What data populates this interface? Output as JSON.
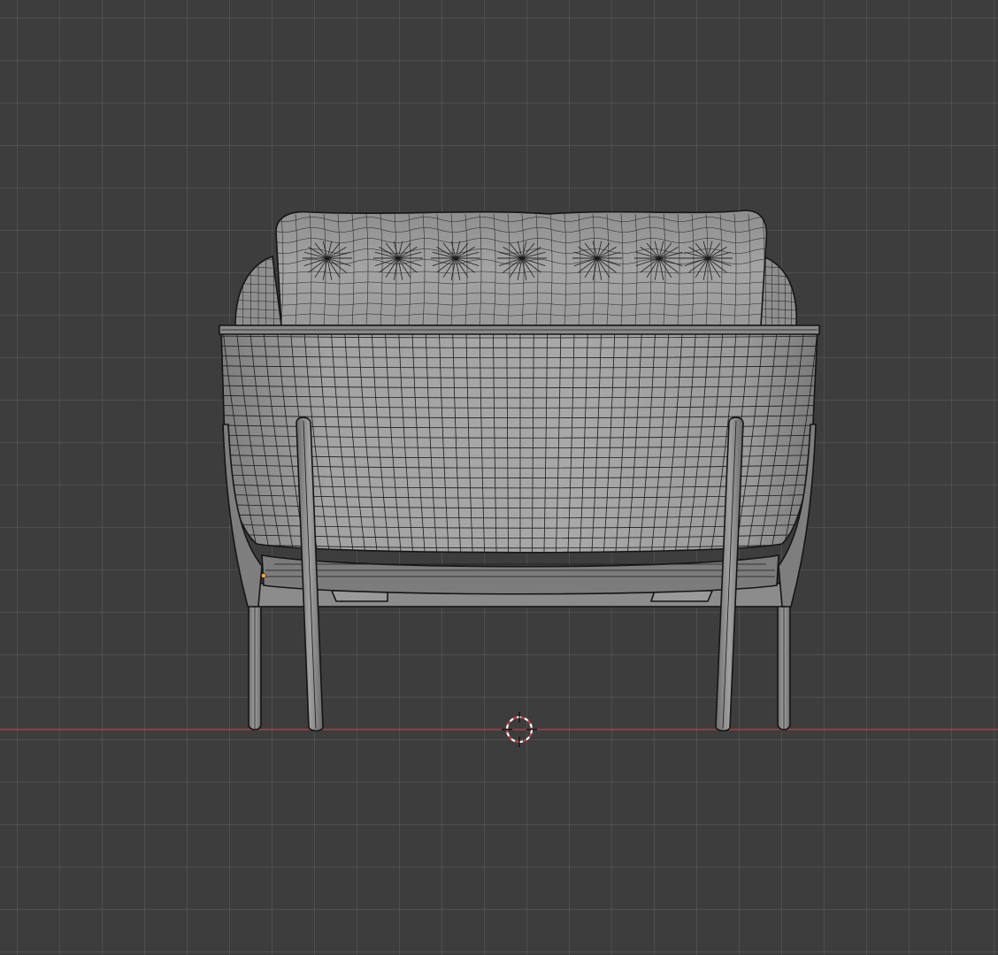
{
  "viewport": {
    "background_color": "#3d3d3d",
    "grid_color": "#4a4a4a",
    "x_axis_color": "#c04848"
  },
  "object": {
    "shading_color": "#9a9a9a",
    "wire_color": "#1c1c1c",
    "leg_color": "#8a8a8a"
  },
  "icons": {
    "cursor": "3d-cursor-icon",
    "origin": "object-origin-icon"
  }
}
